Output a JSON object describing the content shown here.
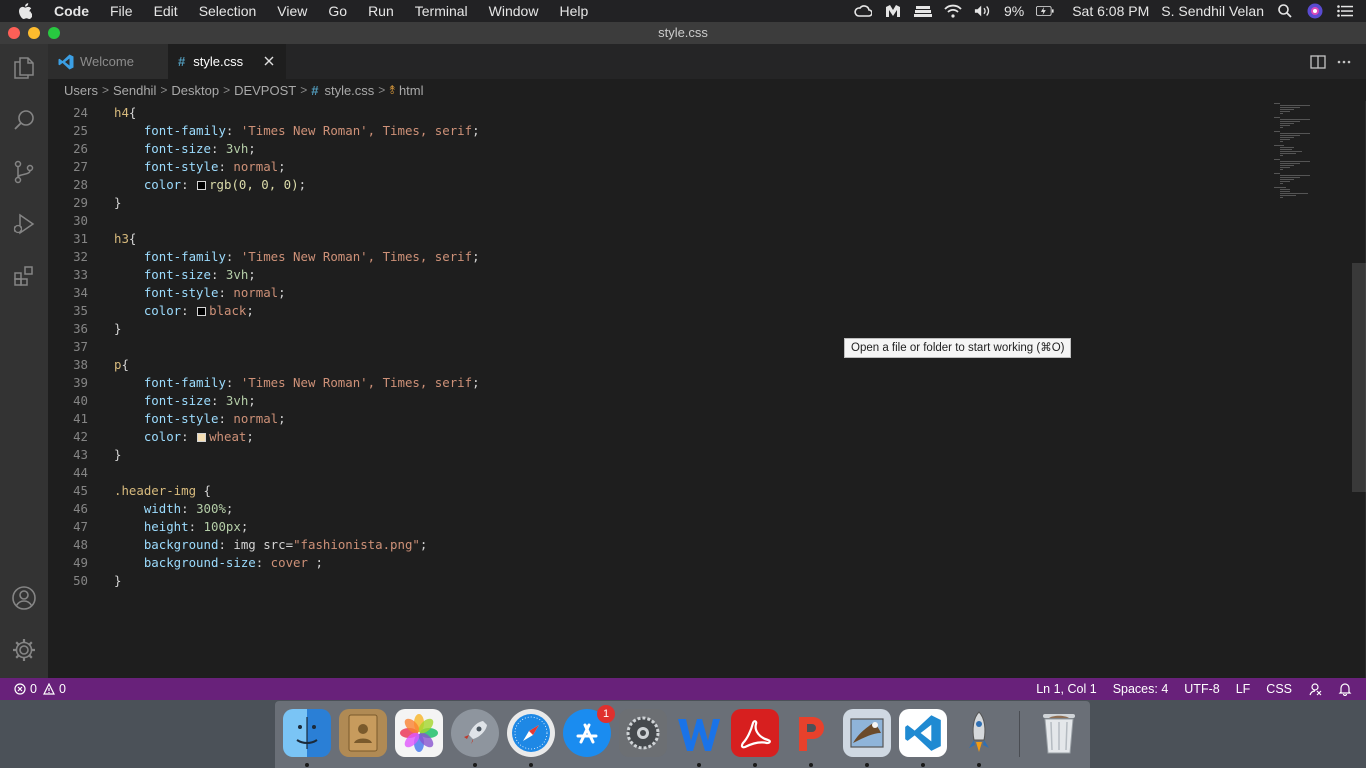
{
  "menubar": {
    "items": [
      "Code",
      "File",
      "Edit",
      "Selection",
      "View",
      "Go",
      "Run",
      "Terminal",
      "Window",
      "Help"
    ],
    "battery": "9%",
    "clock": "Sat 6:08 PM",
    "user": "S. Sendhil Velan"
  },
  "window": {
    "title": "style.css"
  },
  "tabs": [
    {
      "label": "Welcome"
    },
    {
      "label": "style.css"
    }
  ],
  "breadcrumb": {
    "parts": [
      "Users",
      "Sendhil",
      "Desktop",
      "DEVPOST"
    ],
    "file": "style.css",
    "symbol": "html"
  },
  "editor": {
    "line_numbers": [
      "24",
      "25",
      "26",
      "27",
      "28",
      "29",
      "30",
      "31",
      "32",
      "33",
      "34",
      "35",
      "36",
      "37",
      "38",
      "39",
      "40",
      "41",
      "42",
      "43",
      "44",
      "45",
      "46",
      "47",
      "48",
      "49",
      "50"
    ],
    "swatch_colors": {
      "rgb": "#000000",
      "black": "#000000",
      "wheat": "#f5deb3"
    }
  },
  "code": {
    "h4_selector": "h4",
    "h3_selector": "h3",
    "p_selector": "p",
    "header_selector": ".header-img",
    "prop_font_family": "font-family",
    "prop_font_size": "font-size",
    "prop_font_style": "font-style",
    "prop_color": "color",
    "prop_width": "width",
    "prop_height": "height",
    "prop_background": "background",
    "prop_background_size": "background-size",
    "val_font_family": "'Times New Roman', Times, serif",
    "val_3vh": "3vh",
    "val_normal": "normal",
    "val_rgb": "rgb(0, 0, 0)",
    "val_black": "black",
    "val_wheat": "wheat",
    "val_300": "300%",
    "val_100px": "100px",
    "val_img": "img src=",
    "val_img_str": "\"fashionista.png\"",
    "val_cover": "cover"
  },
  "tooltip": "Open a file or folder to start working (⌘O)",
  "statusbar": {
    "errors": "0",
    "warnings": "0",
    "position": "Ln 1, Col 1",
    "spaces": "Spaces: 4",
    "encoding": "UTF-8",
    "eol": "LF",
    "language": "CSS"
  },
  "dock": {
    "app_store_badge": "1",
    "apps": [
      "finder-icon",
      "contacts-icon",
      "photos-icon",
      "launchpad-icon",
      "safari-icon",
      "app-store-icon",
      "system-preferences-icon",
      "word-icon",
      "acrobat-icon",
      "powerpoint-icon",
      "preview-icon",
      "vscode-icon",
      "rocket-icon",
      "trash-icon"
    ]
  },
  "theme": {
    "statusbar_bg": "#68217a",
    "editor_bg": "#1e1e1e",
    "activitybar_bg": "#333333"
  }
}
